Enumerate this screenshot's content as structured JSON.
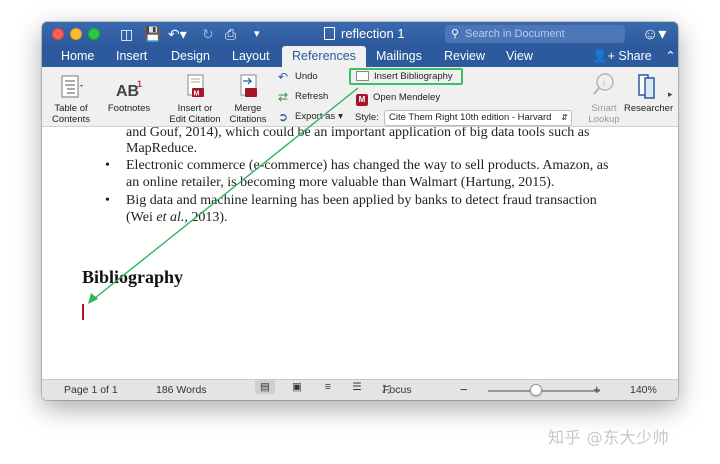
{
  "window": {
    "title": "reflection 1",
    "search_placeholder": "Search in Document"
  },
  "tabs": [
    {
      "label": "Home"
    },
    {
      "label": "Insert"
    },
    {
      "label": "Design"
    },
    {
      "label": "Layout"
    },
    {
      "label": "References",
      "active": true
    },
    {
      "label": "Mailings"
    },
    {
      "label": "Review"
    },
    {
      "label": "View"
    }
  ],
  "share_label": "Share",
  "ribbon": {
    "table_of_contents": "Table of\nContents",
    "footnotes": "Footnotes",
    "insert_citation": "Insert or\nEdit Citation",
    "merge_citations": "Merge\nCitations",
    "undo": "Undo",
    "refresh": "Refresh",
    "export_as": "Export as",
    "insert_bibliography": "Insert Bibliography",
    "open_mendeley": "Open Mendeley",
    "style_label": "Style:",
    "style_value": "Cite Them Right 10th edition - Harvard",
    "smart_lookup": "Smart\nLookup",
    "researcher": "Researcher"
  },
  "document": {
    "partial_line": "and Gouf, 2014), which could be an important application of big data tools such as",
    "line_mapreduce": "MapReduce.",
    "bullet2_line1": "Electronic commerce (e-commerce) has changed the way to sell products. Amazon, as",
    "bullet2_line2": "an online retailer, is becoming more valuable than Walmart (Hartung, 2015).",
    "bullet3_line1": "Big data and machine learning has been applied by banks to detect fraud transaction",
    "bullet3_line2_a": "(Wei ",
    "bullet3_line2_b": "et al.",
    "bullet3_line2_c": ", 2013).",
    "heading": "Bibliography"
  },
  "status": {
    "page": "Page 1 of 1",
    "words": "186 Words",
    "focus": "Focus",
    "zoom": "140%",
    "zoom_value": 140
  },
  "watermark": "知乎 @东大少帅",
  "colors": {
    "ribbon_blue": "#2c5a9c",
    "highlight_green": "#3cbf67",
    "arrow_green": "#2fb55a"
  }
}
